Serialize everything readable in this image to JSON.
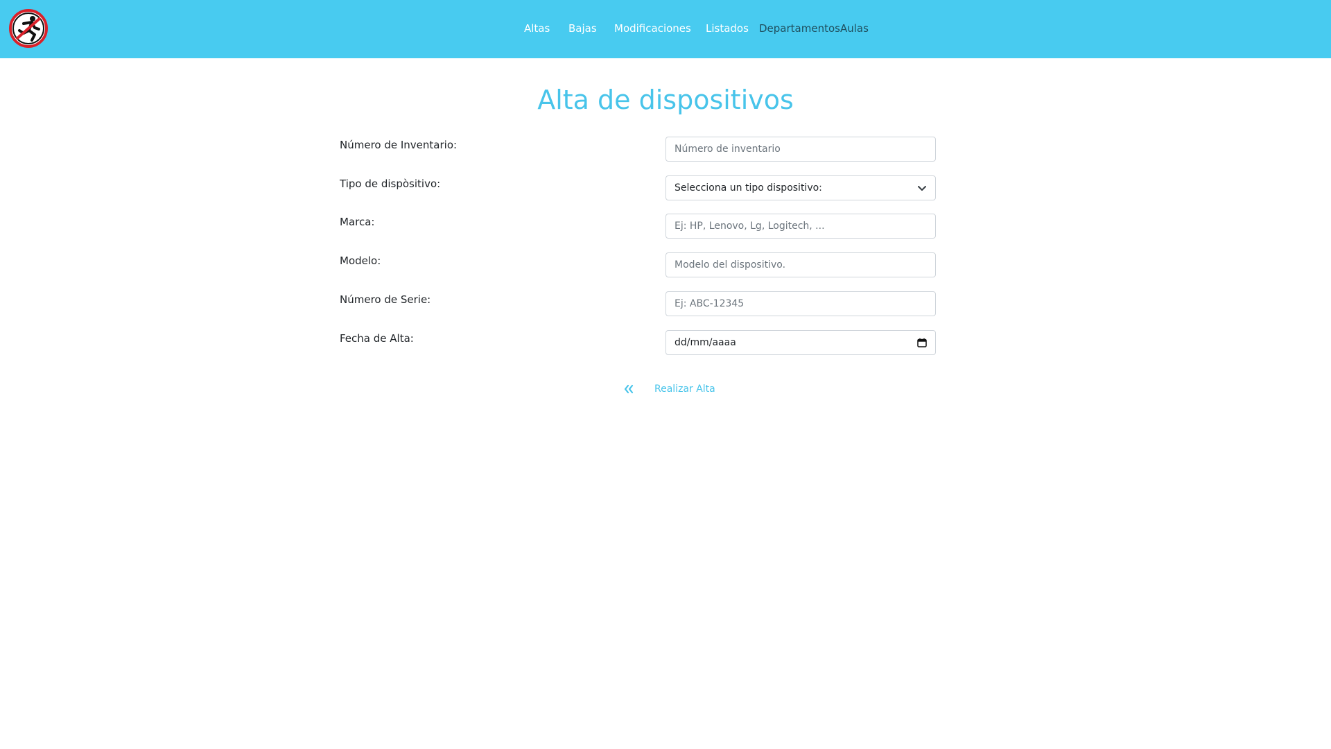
{
  "nav": {
    "items": [
      {
        "label": "Altas"
      },
      {
        "label": "Bajas"
      },
      {
        "label": "Modificaciones"
      },
      {
        "label": "Listados"
      },
      {
        "label": "Departamentos"
      },
      {
        "label": "Aulas"
      }
    ],
    "logo_icon": "no-running-sign-icon"
  },
  "page": {
    "title": "Alta de dispositivos"
  },
  "form": {
    "inventory": {
      "label": "Número de Inventario:",
      "placeholder": "Número de inventario",
      "value": ""
    },
    "device_type": {
      "label": "Tipo de dispòsitivo:",
      "selected": "Selecciona un tipo dispositivo:"
    },
    "brand": {
      "label": "Marca:",
      "placeholder": "Ej: HP, Lenovo, Lg, Logitech, ...",
      "value": ""
    },
    "model": {
      "label": "Modelo:",
      "placeholder": "Modelo del dispositivo.",
      "value": ""
    },
    "serial": {
      "label": "Número de Serie:",
      "placeholder": "Ej: ABC-12345",
      "value": ""
    },
    "date": {
      "label": "Fecha de Alta:",
      "value": "dd/mm/aaaa"
    }
  },
  "actions": {
    "back_icon": "double-chevron-left-icon",
    "submit_label": "Realizar Alta"
  },
  "colors": {
    "navbar": "#48cbf0",
    "accent": "#48c4ea",
    "logo_ring": "#d9202a"
  }
}
